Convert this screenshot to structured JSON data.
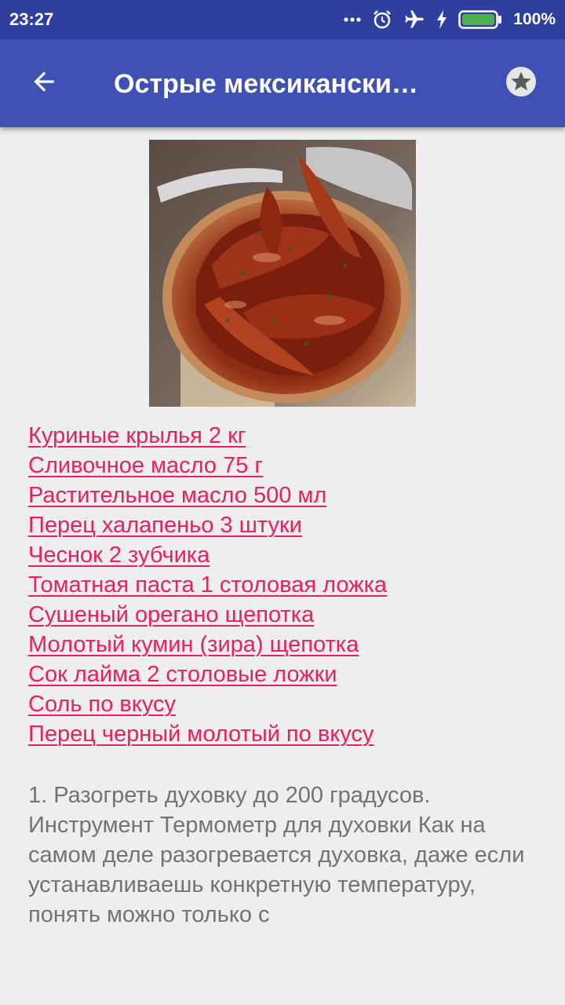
{
  "status_bar": {
    "time": "23:27",
    "battery_percent": "100%",
    "icons": [
      "more-dots-icon",
      "alarm-icon",
      "airplane-icon",
      "charging-icon",
      "battery-icon"
    ],
    "color": "#303f9f"
  },
  "app_bar": {
    "title": "Острые мексикански…",
    "back_icon": "arrow-back-icon",
    "favorite_icon": "star-icon",
    "color": "#3f51b5"
  },
  "recipe": {
    "image": "photo of spicy glazed chicken wings in a copper bowl",
    "ingredients": [
      "Куриные крылья 2 кг",
      "Сливочное масло 75 г",
      "Растительное масло 500 мл",
      "Перец халапеньо 3 штуки",
      "Чеснок 2 зубчика",
      "Томатная паста 1 столовая ложка",
      "Сушеный орегано щепотка",
      "Молотый кумин (зира) щепотка",
      "Сок лайма 2 столовые ложки",
      "Соль по вкусу",
      "Перец черный молотый по вкусу"
    ],
    "instructions": "1. Разогреть духовку до 200 градусов. Инструмент Термометр для духовки Как на самом деле разогревается духовка, даже если устанавливаешь конкретную температуру, понять можно только с",
    "link_color": "#e91e63",
    "text_color": "#737373"
  }
}
